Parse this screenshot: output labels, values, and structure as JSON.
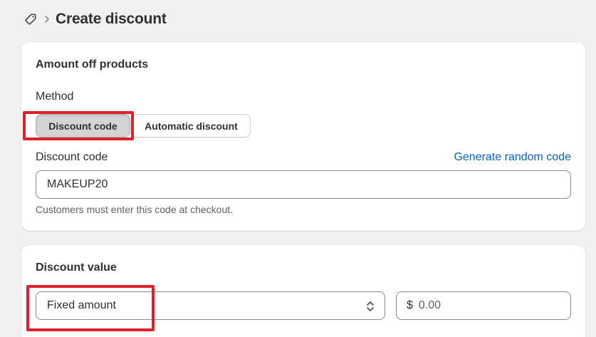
{
  "header": {
    "icon": "tag-icon",
    "separator_icon": "chevron-right-icon",
    "title": "Create discount"
  },
  "discount_card": {
    "title": "Amount off products",
    "method_label": "Method",
    "method_options": [
      {
        "label": "Discount code",
        "selected": true
      },
      {
        "label": "Automatic discount",
        "selected": false
      }
    ],
    "code_label": "Discount code",
    "generate_link": "Generate random code",
    "code_value": "MAKEUP20",
    "help_text": "Customers must enter this code at checkout."
  },
  "value_card": {
    "title": "Discount value",
    "type_select": {
      "value": "Fixed amount",
      "icon": "select-arrows-icon"
    },
    "amount": {
      "currency": "$",
      "placeholder": "0.00"
    }
  },
  "colors": {
    "highlight": "#e0202a",
    "link": "#0b63c5",
    "background": "#f1f1f1"
  }
}
